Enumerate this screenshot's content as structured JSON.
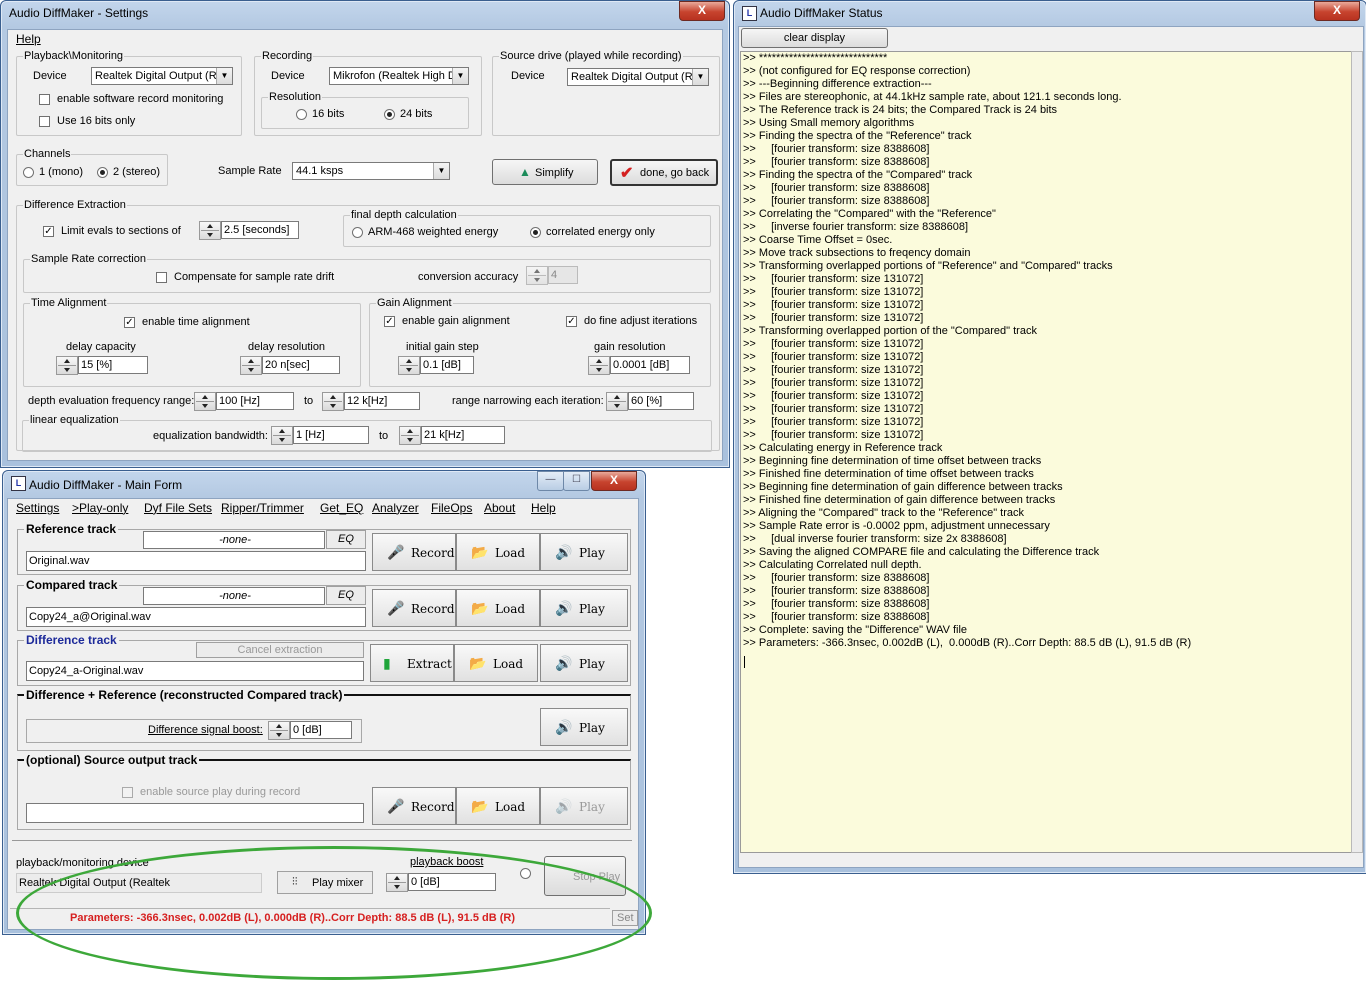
{
  "settings": {
    "title": "Audio DiffMaker - Settings",
    "menu_help": "Help",
    "playback": {
      "group_label": "Playback\\Monitoring",
      "device_label": "Device",
      "device_value": "Realtek Digital Output (Re",
      "enable_sw_monitor": "enable software record monitoring",
      "use16": "Use 16 bits only"
    },
    "recording": {
      "group_label": "Recording",
      "device_label": "Device",
      "device_value": "Mikrofon (Realtek High D",
      "resolution_label": "Resolution",
      "opt16": "16 bits",
      "opt24": "24 bits"
    },
    "source": {
      "group_label": "Source drive (played while recording)",
      "device_label": "Device",
      "device_value": "Realtek Digital Output (Re"
    },
    "channels": {
      "group_label": "Channels",
      "mono": "1 (mono)",
      "stereo": "2 (stereo)"
    },
    "sample_rate_label": "Sample Rate",
    "sample_rate_value": "44.1 ksps",
    "simplify_label": "Simplify",
    "done_label": "done, go back",
    "diff_extraction": {
      "group_label": "Difference Extraction",
      "limit_label": "Limit evals to sections of",
      "limit_value": "2.5 [seconds]",
      "final_depth_label": "final depth calculation",
      "arm468": "ARM-468 weighted energy",
      "correlated": "correlated energy only"
    },
    "src_correction": {
      "group_label": "Sample Rate correction",
      "compensate": "Compensate for sample rate drift",
      "accuracy_label": "conversion accuracy",
      "accuracy_value": "4"
    },
    "time_alignment": {
      "group_label": "Time Alignment",
      "enable": "enable time alignment",
      "capacity_label": "delay capacity",
      "capacity_value": "15 [%]",
      "resolution_label": "delay resolution",
      "resolution_value": "20 n[sec]"
    },
    "gain_alignment": {
      "group_label": "Gain Alignment",
      "enable": "enable gain alignment",
      "fine": "do fine adjust iterations",
      "step_label": "initial gain step",
      "step_value": "0.1 [dB]",
      "resolution_label": "gain resolution",
      "resolution_value": "0.0001 [dB]"
    },
    "depth_range": {
      "label": "depth evaluation frequency range:",
      "from": "100 [Hz]",
      "to_label": "to",
      "to": "12 k[Hz]",
      "narrowing_label": "range narrowing each iteration:",
      "narrowing_value": "60 [%]"
    },
    "linear_eq": {
      "group_label": "linear equalization",
      "bandwidth_label": "equalization bandwidth:",
      "from": "1 [Hz]",
      "to_label": "to",
      "to": "21 k[Hz]"
    }
  },
  "status_window": {
    "title": "Audio DiffMaker Status",
    "clear_label": "clear display",
    "close": "X",
    "lines": [
      ">> ******************************",
      ">> (not configured for EQ response correction)",
      ">> ---Beginning difference extraction---",
      ">> Files are stereophonic, at 44.1kHz sample rate, about 121.1 seconds long.",
      ">> The Reference track is 24 bits; the Compared Track is 24 bits",
      ">> Using Small memory algorithms",
      ">> Finding the spectra of the \"Reference\" track",
      ">>     [fourier transform: size 8388608]",
      ">>     [fourier transform: size 8388608]",
      ">> Finding the spectra of the \"Compared\" track",
      ">>     [fourier transform: size 8388608]",
      ">>     [fourier transform: size 8388608]",
      ">> Correlating the \"Compared\" with the \"Reference\"",
      ">>     [inverse fourier transform: size 8388608]",
      ">> Coarse Time Offset = 0sec.",
      ">> Move track subsections to freqency domain",
      ">> Transforming overlapped portions of \"Reference\" and \"Compared\" tracks",
      ">>     [fourier transform: size 131072]",
      ">>     [fourier transform: size 131072]",
      ">>     [fourier transform: size 131072]",
      ">>     [fourier transform: size 131072]",
      ">> Transforming overlapped portion of the \"Compared\" track",
      ">>     [fourier transform: size 131072]",
      ">>     [fourier transform: size 131072]",
      ">>     [fourier transform: size 131072]",
      ">>     [fourier transform: size 131072]",
      ">>     [fourier transform: size 131072]",
      ">>     [fourier transform: size 131072]",
      ">>     [fourier transform: size 131072]",
      ">>     [fourier transform: size 131072]",
      ">> Calculating energy in Reference track",
      ">> Beginning fine determination of time offset between tracks",
      ">> Finished fine determination of time offset between tracks",
      ">> Beginning fine determination of gain difference between tracks",
      ">> Finished fine determination of gain difference between tracks",
      ">> Aligning the \"Compared\" track to the \"Reference\" track",
      ">> Sample Rate error is -0.0002 ppm, adjustment unnecessary",
      ">>     [dual inverse fourier transform: size 2x 8388608]",
      ">> Saving the aligned COMPARE file and calculating the Difference track",
      ">> Calculating Correlated null depth.",
      ">>     [fourier transform: size 8388608]",
      ">>     [fourier transform: size 8388608]",
      ">>     [fourier transform: size 8388608]",
      ">>     [fourier transform: size 8388608]",
      ">> Complete: saving the \"Difference\" WAV file",
      ">> Parameters: -366.3nsec, 0.002dB (L),  0.000dB (R)..Corr Depth: 88.5 dB (L), 91.5 dB (R)"
    ]
  },
  "main": {
    "title": "Audio DiffMaker - Main Form",
    "menu": [
      "Settings",
      ">Play-only",
      "Dyf File Sets",
      "Ripper/Trimmer",
      "Get_EQ",
      "Analyzer",
      "FileOps",
      "About",
      "Help"
    ],
    "reference": {
      "label": "Reference track",
      "eq_value": "-none-",
      "eq_btn": "EQ",
      "file": "Original.wav",
      "record": "Record",
      "load": "Load",
      "play": "Play"
    },
    "compared": {
      "label": "Compared track",
      "eq_value": "-none-",
      "eq_btn": "EQ",
      "file": "Copy24_a@Original.wav",
      "record": "Record",
      "load": "Load",
      "play": "Play"
    },
    "difference": {
      "label": "Difference track",
      "cancel": "Cancel extraction",
      "file": "Copy24_a-Original.wav",
      "extract": "Extract",
      "load": "Load",
      "play": "Play"
    },
    "diff_plus_ref": {
      "label": "Difference + Reference   (reconstructed Compared track)",
      "boost_label": "Difference signal boost:",
      "boost_value": "0 [dB]",
      "play": "Play"
    },
    "source_output": {
      "label": "(optional) Source output track",
      "enable_play": "enable source play during record",
      "record": "Record",
      "load": "Load",
      "play": "Play"
    },
    "playback_device_label": "playback/monitoring device",
    "playback_device_value": "Realtek Digital Output (Realtek",
    "play_mixer": "Play mixer",
    "playback_boost_label": "playback boost",
    "playback_boost_value": "0 [dB]",
    "stop_play": "Stop Play",
    "status_text": "Parameters: -366.3nsec, 0.002dB (L),  0.000dB (R)..Corr Depth: 88.5 dB (L), 91.5 dB (R)",
    "set_label": "Set"
  },
  "colors": {
    "status_red": "#d62020",
    "highlight_ellipse": "#3da83a",
    "status_bg": "#fbfbdc"
  }
}
